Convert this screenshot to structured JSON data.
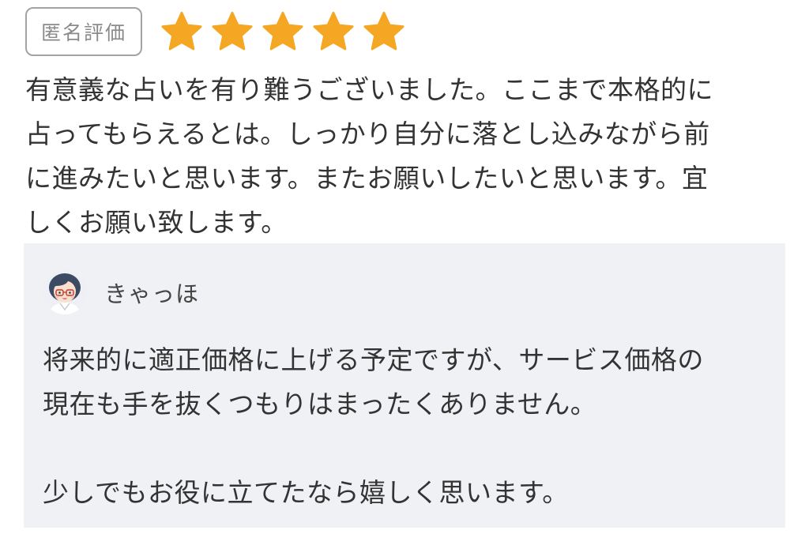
{
  "review": {
    "anonymous_label": "匿名評価",
    "rating": 5,
    "rating_max": 5,
    "star_color": "#f5a623",
    "lines": [
      "有意義な占いを有り難うございました。ここまで本格的に",
      "占ってもらえるとは。しっかり自分に落とし込みながら前",
      "に進みたいと思います。またお願いしたいと思います。宜",
      "しくお願い致します。"
    ]
  },
  "reply": {
    "author_name": "きゃっほ",
    "avatar_icon": "avatar-icon",
    "background_color": "#f0f1f4",
    "paragraph1": [
      "将来的に適正価格に上げる予定ですが、サービス価格の",
      "現在も手を抜くつもりはまったくありません。"
    ],
    "paragraph2": "少しでもお役に立てたなら嬉しく思います。"
  }
}
